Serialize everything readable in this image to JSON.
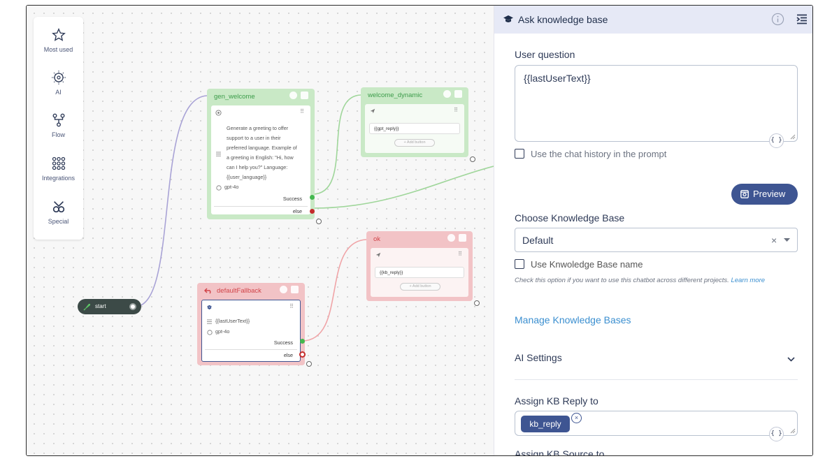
{
  "palette": {
    "items": [
      {
        "label": "Most used"
      },
      {
        "label": "AI"
      },
      {
        "label": "Flow"
      },
      {
        "label": "Integrations"
      },
      {
        "label": "Special"
      }
    ]
  },
  "nodes": {
    "gen_welcome": {
      "title": "gen_welcome",
      "prompt_lines": [
        "Generate a greeting to offer",
        "support to a user in their",
        "preferred language. Example of",
        "a greeting in English: \"Hi, how",
        "can I help you?\" Language:",
        "{{user_language}}"
      ],
      "model": "gpt-4o",
      "success_label": "Success",
      "else_label": "else"
    },
    "welcome_dynamic": {
      "title": "welcome_dynamic",
      "reply": "{{gpt_reply}}",
      "add_button": "+ Add button"
    },
    "ok": {
      "title": "ok",
      "reply": "{{kb_reply}}",
      "add_button": "+ Add button"
    },
    "defaultFallback": {
      "title": "defaultFallback",
      "question": "{{lastUserText}}",
      "model": "gpt-4o",
      "success_label": "Success",
      "else_label": "else"
    },
    "start": {
      "label": "start"
    }
  },
  "panel": {
    "title": "Ask knowledge base",
    "user_question_label": "User question",
    "user_question_value": "{{lastUserText}}",
    "brace_label": "{ }",
    "chat_history_label": "Use the chat history in the prompt",
    "preview_label": "Preview",
    "choose_kb_label": "Choose Knowledge Base",
    "kb_selected": "Default",
    "clear_symbol": "×",
    "use_kb_name_label": "Use Knwoledge Base name",
    "hint_text": "Check this option if you want to use this chatbot across different projects.",
    "hint_link": "Learn more",
    "manage_kb_link": "Manage Knowledge Bases",
    "ai_settings_label": "AI Settings",
    "assign_reply_label": "Assign KB Reply to",
    "reply_chip": "kb_reply",
    "chip_remove": "×",
    "assign_source_label": "Assign KB Source to"
  },
  "colors": {
    "accent": "#3e5592",
    "green_node": "#c9e9c6",
    "red_node": "#f2c3c6",
    "link": "#3b8fd0"
  }
}
